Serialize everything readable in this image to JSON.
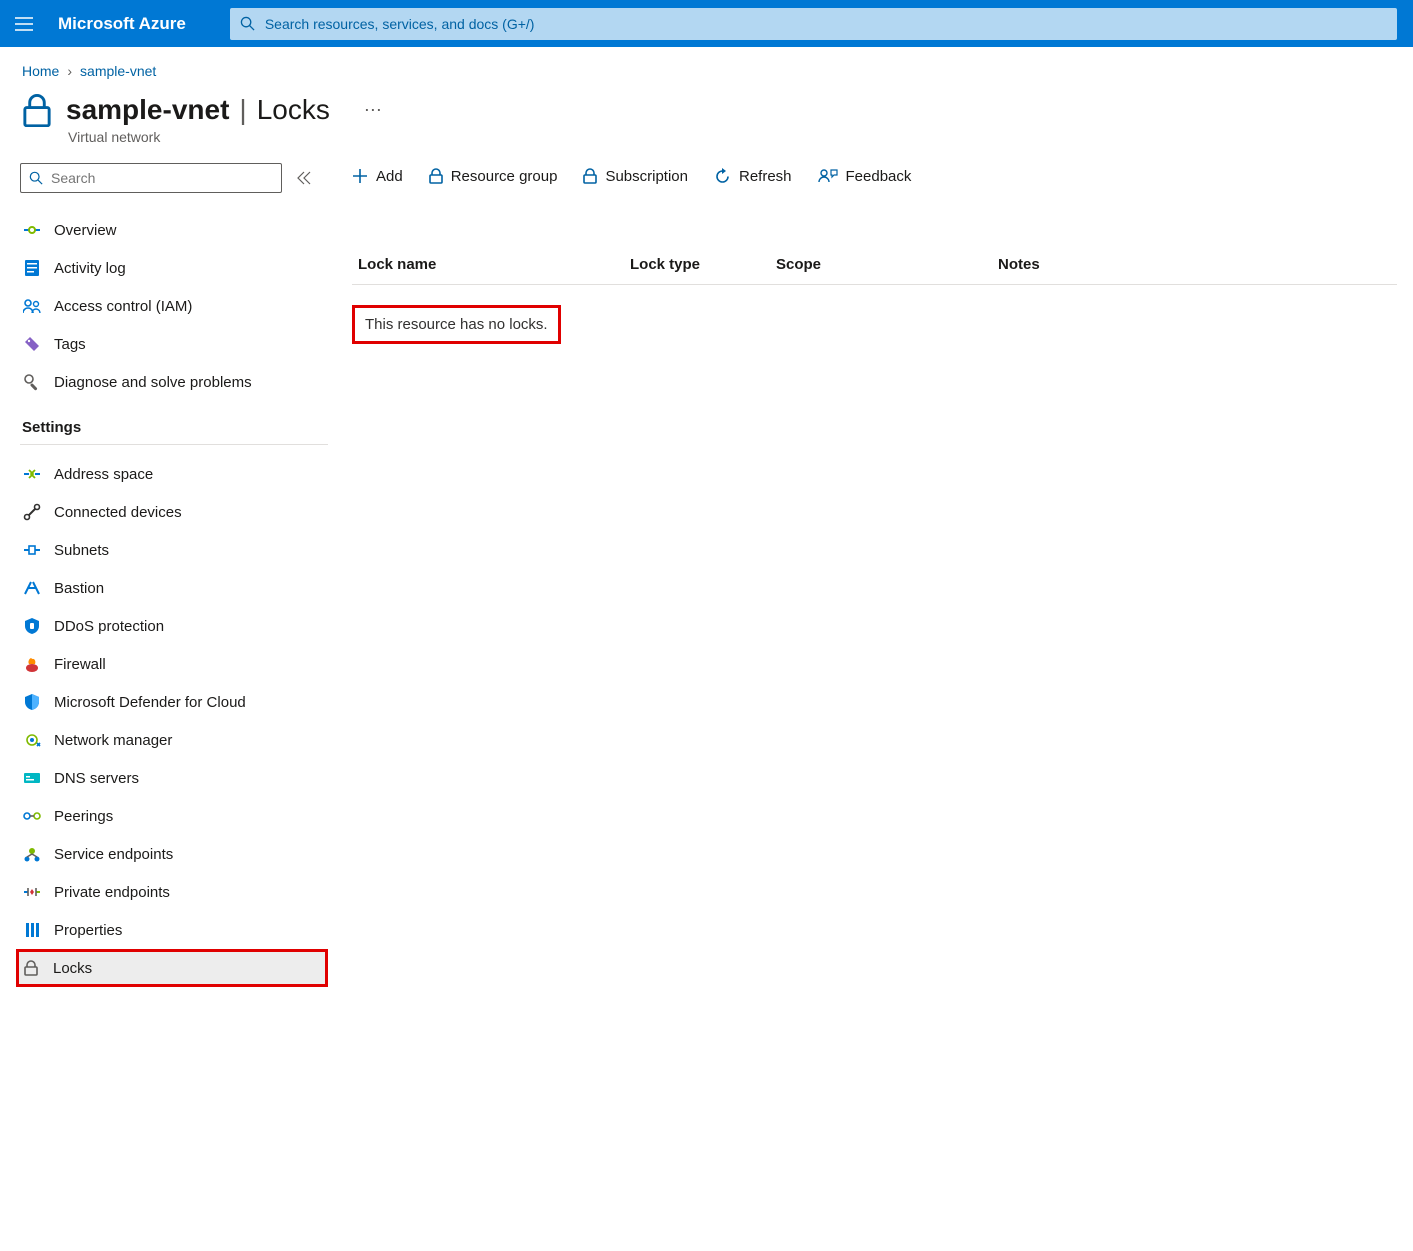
{
  "header": {
    "brand": "Microsoft Azure",
    "search_placeholder": "Search resources, services, and docs (G+/)"
  },
  "breadcrumb": {
    "home": "Home",
    "current": "sample-vnet"
  },
  "title": {
    "resource_name": "sample-vnet",
    "section": "Locks",
    "subtitle": "Virtual network"
  },
  "sidebar": {
    "search_placeholder": "Search",
    "items_top": [
      {
        "label": "Overview",
        "icon": "overview"
      },
      {
        "label": "Activity log",
        "icon": "activity"
      },
      {
        "label": "Access control (IAM)",
        "icon": "iam"
      },
      {
        "label": "Tags",
        "icon": "tags"
      },
      {
        "label": "Diagnose and solve problems",
        "icon": "diagnose"
      }
    ],
    "settings_title": "Settings",
    "items_settings": [
      {
        "label": "Address space",
        "icon": "address"
      },
      {
        "label": "Connected devices",
        "icon": "devices"
      },
      {
        "label": "Subnets",
        "icon": "subnets"
      },
      {
        "label": "Bastion",
        "icon": "bastion"
      },
      {
        "label": "DDoS protection",
        "icon": "ddos"
      },
      {
        "label": "Firewall",
        "icon": "firewall"
      },
      {
        "label": "Microsoft Defender for Cloud",
        "icon": "defender"
      },
      {
        "label": "Network manager",
        "icon": "netmgr"
      },
      {
        "label": "DNS servers",
        "icon": "dns"
      },
      {
        "label": "Peerings",
        "icon": "peerings"
      },
      {
        "label": "Service endpoints",
        "icon": "svcend"
      },
      {
        "label": "Private endpoints",
        "icon": "pvtend"
      },
      {
        "label": "Properties",
        "icon": "props"
      },
      {
        "label": "Locks",
        "icon": "lock",
        "selected": true
      }
    ]
  },
  "toolbar": {
    "add": "Add",
    "rg": "Resource group",
    "sub": "Subscription",
    "refresh": "Refresh",
    "feedback": "Feedback"
  },
  "table": {
    "col_name": "Lock name",
    "col_type": "Lock type",
    "col_scope": "Scope",
    "col_notes": "Notes"
  },
  "empty_message": "This resource has no locks."
}
